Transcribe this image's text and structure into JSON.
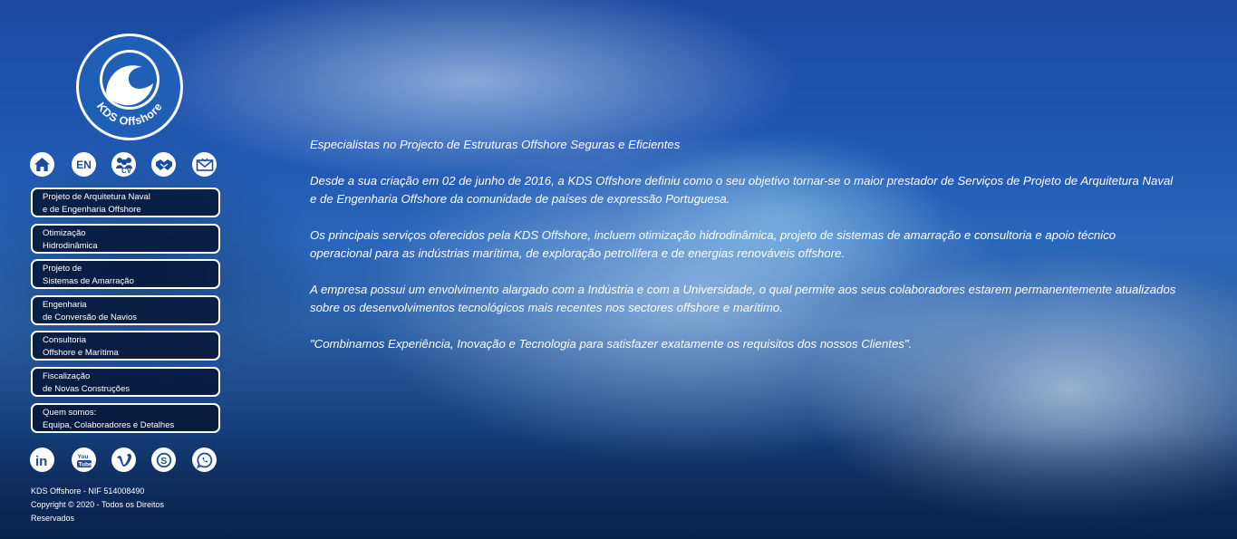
{
  "logo": {
    "text": "KDS Offshore"
  },
  "top_icons": [
    {
      "name": "home-icon"
    },
    {
      "name": "language-en",
      "label": "EN"
    },
    {
      "name": "cv-team-icon",
      "label": "CV"
    },
    {
      "name": "handshake-icon"
    },
    {
      "name": "mail-icon"
    }
  ],
  "menu": [
    {
      "line1": "Projeto de Arquitetura Naval",
      "line2": "e de Engenharia Offshore"
    },
    {
      "line1": "Otimização",
      "line2": "Hidrodinâmica"
    },
    {
      "line1": "Projeto de",
      "line2": "Sistemas de Amarração"
    },
    {
      "line1": "Engenharia",
      "line2": "de Conversão de Navios"
    },
    {
      "line1": "Consultoria",
      "line2": "Offshore e Marítima"
    },
    {
      "line1": "Fiscalização",
      "line2": "de Novas Construções"
    },
    {
      "line1": "Quem somos:",
      "line2": "Equipa, Colaboradores e Detalhes"
    }
  ],
  "social_icons": [
    {
      "name": "linkedin-icon",
      "label": "in"
    },
    {
      "name": "youtube-icon",
      "label": "You Tube"
    },
    {
      "name": "vimeo-icon",
      "label": "V"
    },
    {
      "name": "skype-icon",
      "label": "S"
    },
    {
      "name": "whatsapp-icon"
    }
  ],
  "footer": {
    "line1": "KDS Offshore - NIF 514008490",
    "line2": "Copyright © 2020 - Todos os Direitos",
    "line3": "Reservados"
  },
  "content": {
    "p1": {
      "a": "Especialistas no ",
      "b": "Projecto",
      "c": " de ",
      "d": "Estruturas Offshore Seguras",
      "e": " e ",
      "f": "Eficientes"
    },
    "p2": "Desde a sua criação em 02 de junho de 2016, a KDS Offshore definiu como o seu objetivo tornar-se o maior prestador de Serviços de Projeto de Arquitetura Naval e de Engenharia Offshore da comunidade de países de expressão Portuguesa.",
    "p3": "Os principais serviços oferecidos pela KDS Offshore, incluem otimização hidrodinâmica, projeto de sistemas de amarração e consultoria e apoio técnico operacional para as indústrias marítima, de exploração petrolífera e de energias renováveis offshore.",
    "p4": "A empresa possui um envolvimento alargado com a Indústria e com a Universidade, o qual permite aos seus colaboradores estarem permanentemente atualizados sobre os desenvolvimentos tecnológicos mais recentes nos sectores offshore e marítimo.",
    "p5": {
      "a": "\"Combinamos ",
      "b": "Experiência",
      "c": ", ",
      "d": "Inovação",
      "e": " e ",
      "f": "Tecnologia",
      "g": " para satisfazer exatamente os requisitos dos nossos ",
      "h": "Clientes",
      "i": "\"."
    }
  },
  "colors": {
    "accent": "#1f5fb6",
    "menu_bg": "#05142f",
    "text": "#ffffff"
  }
}
